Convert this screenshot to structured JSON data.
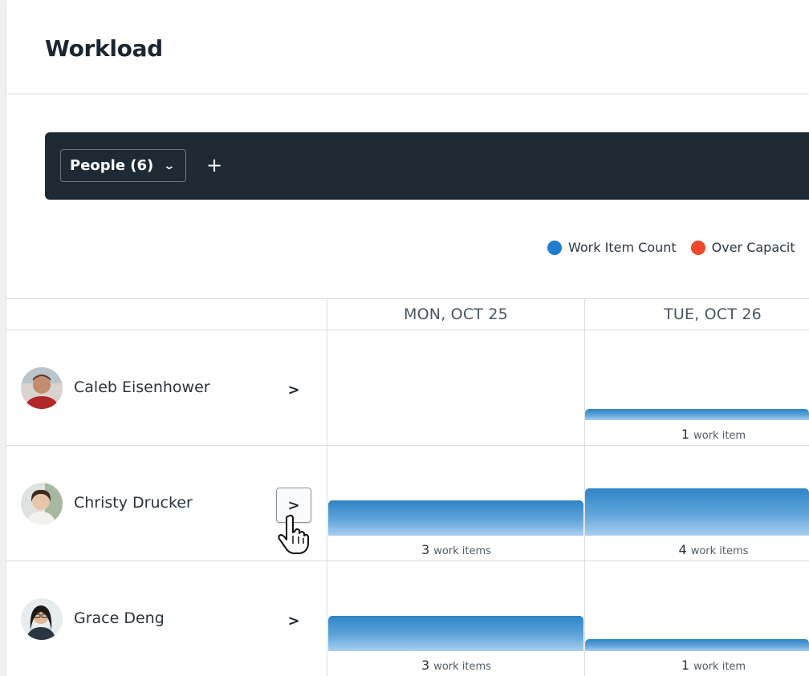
{
  "page": {
    "title": "Workload"
  },
  "toolbar": {
    "people_label": "People (6)",
    "add_label": "+"
  },
  "legend": [
    {
      "label": "Work Item Count",
      "color": "#1f7ccf"
    },
    {
      "label": "Over Capacit",
      "color": "#f0462b"
    }
  ],
  "days": [
    "MON, OCT 25",
    "TUE, OCT 26"
  ],
  "people": [
    {
      "name": "Caleb Eisenhower",
      "expand_icon": ">",
      "cells": [
        {
          "count": "",
          "unit": ""
        },
        {
          "count": "1",
          "unit": "work item"
        }
      ]
    },
    {
      "name": "Christy Drucker",
      "expand_icon": ">",
      "cells": [
        {
          "count": "3",
          "unit": "work items"
        },
        {
          "count": "4",
          "unit": "work items"
        }
      ]
    },
    {
      "name": "Grace Deng",
      "expand_icon": ">",
      "cells": [
        {
          "count": "3",
          "unit": "work items"
        },
        {
          "count": "1",
          "unit": "work item"
        }
      ]
    }
  ]
}
